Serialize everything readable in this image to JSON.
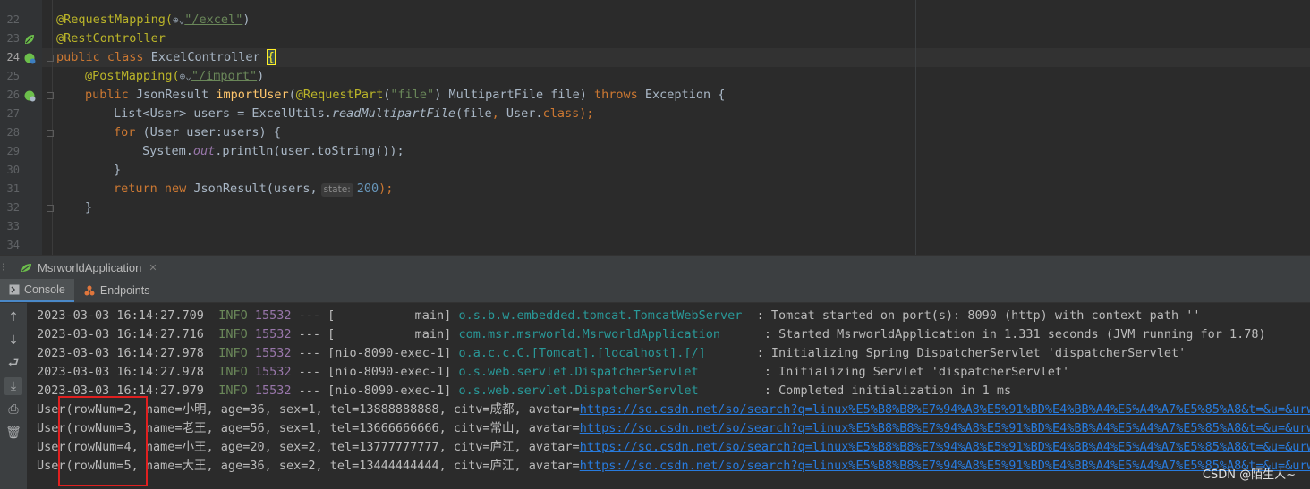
{
  "editor": {
    "line_numbers": [
      "22",
      "23",
      "24",
      "25",
      "26",
      "27",
      "28",
      "29",
      "30",
      "31",
      "32",
      "33",
      "34"
    ],
    "lines": {
      "l22": {
        "annotation": "@RequestMapping(",
        "globe": "⊕⌄",
        "path": "\"/excel\"",
        "close": ")"
      },
      "l23": {
        "annotation": "@RestController"
      },
      "l24": {
        "kw1": "public ",
        "kw2": "class ",
        "name": "ExcelController ",
        "brace": "{"
      },
      "l25": {
        "annotation": "@PostMapping(",
        "globe": "⊕⌄",
        "path": "\"/import\"",
        "close": ")"
      },
      "l26": {
        "kw1": "public ",
        "type": "JsonResult ",
        "method": "importUser",
        "open": "(",
        "param_ann": "@RequestPart",
        "paren": "(",
        "str": "\"file\"",
        "rest": ") MultipartFile file) ",
        "throws": "throws ",
        "exc": "Exception {"
      },
      "l27": {
        "pre": "List<User> users = ExcelUtils.",
        "call": "readMultipartFile",
        "args": "(file",
        "comma": ", ",
        "cls": "User.",
        "kw": "class",
        "end": ");"
      },
      "l28": {
        "kw": "for ",
        "rest": "(User user:users) {"
      },
      "l29": {
        "pre": "System.",
        "field": "out",
        "rest": ".println(user.toString());"
      },
      "l30": {
        "text": "}"
      },
      "l31": {
        "kw1": "return ",
        "kw2": "new ",
        "rest": "JsonResult(users,",
        "hint": "state:",
        "num": "200",
        "end": ");"
      },
      "l32": {
        "text": "}"
      }
    }
  },
  "run_panel": {
    "tab_label": "MsrworldApplication",
    "tab_close": "✕",
    "sub_tabs": [
      {
        "label": "Console"
      },
      {
        "label": "Endpoints"
      }
    ]
  },
  "console": {
    "logs": [
      {
        "ts": "2023-03-03 16:14:27.709",
        "level": "INFO",
        "pid": "15532",
        "thread": " --- [           main] ",
        "logger": "o.s.b.w.embedded.tomcat.TomcatWebServer ",
        "msg": " : Tomcat started on port(s): 8090 (http) with context path ''"
      },
      {
        "ts": "2023-03-03 16:14:27.716",
        "level": "INFO",
        "pid": "15532",
        "thread": " --- [           main] ",
        "logger": "com.msr.msrworld.MsrworldApplication     ",
        "msg": " : Started MsrworldApplication in 1.331 seconds (JVM running for 1.78)"
      },
      {
        "ts": "2023-03-03 16:14:27.978",
        "level": "INFO",
        "pid": "15532",
        "thread": " --- [nio-8090-exec-1] ",
        "logger": "o.a.c.c.C.[Tomcat].[localhost].[/]      ",
        "msg": " : Initializing Spring DispatcherServlet 'dispatcherServlet'"
      },
      {
        "ts": "2023-03-03 16:14:27.978",
        "level": "INFO",
        "pid": "15532",
        "thread": " --- [nio-8090-exec-1] ",
        "logger": "o.s.web.servlet.DispatcherServlet        ",
        "msg": " : Initializing Servlet 'dispatcherServlet'"
      },
      {
        "ts": "2023-03-03 16:14:27.979",
        "level": "INFO",
        "pid": "15532",
        "thread": " --- [nio-8090-exec-1] ",
        "logger": "o.s.web.servlet.DispatcherServlet        ",
        "msg": " : Completed initialization in 1 ms"
      }
    ],
    "users": [
      {
        "text": "User(rowNum=2, name=小明, age=36, sex=1, tel=13888888888, citv=成都, avatar=",
        "url": "https://so.csdn.net/so/search?q=linux%E5%B8%B8%E7%94%A8%E5%91%BD%E4%BB%A4%E5%A4%A7%E5%85%A8&t=&u=&urw=",
        "end": ")"
      },
      {
        "text": "User(rowNum=3, name=老王, age=56, sex=1, tel=13666666666, citv=常山, avatar=",
        "url": "https://so.csdn.net/so/search?q=linux%E5%B8%B8%E7%94%A8%E5%91%BD%E4%BB%A4%E5%A4%A7%E5%85%A8&t=&u=&urw=",
        "end": ")"
      },
      {
        "text": "User(rowNum=4, name=小王, age=20, sex=2, tel=13777777777, citv=庐江, avatar=",
        "url": "https://so.csdn.net/so/search?q=linux%E5%B8%B8%E7%94%A8%E5%91%BD%E4%BB%A4%E5%A4%A7%E5%85%A8&t=&u=&urw=",
        "end": ")"
      },
      {
        "text": "User(rowNum=5, name=大王, age=36, sex=2, tel=13444444444, citv=庐江, avatar=",
        "url": "https://so.csdn.net/so/search?q=linux%E5%B8%B8%E7%94%A8%E5%91%BD%E4%BB%A4%E5%A4%A7%E5%85%A8&t=&u=&urw=",
        "end": ")"
      }
    ]
  },
  "watermark": "CSDN @陌生人~",
  "icons": {
    "up": "scroll-up-icon",
    "down": "scroll-down-icon",
    "wrap": "soft-wrap-icon",
    "scroll_end": "scroll-to-end-icon",
    "print": "print-icon",
    "trash": "clear-all-icon"
  },
  "colors": {
    "keyword": "#cc7832",
    "annotation": "#bbb529",
    "string": "#6a8759",
    "number": "#6897bb",
    "link": "#287bde",
    "highlight_box": "#e02020"
  }
}
